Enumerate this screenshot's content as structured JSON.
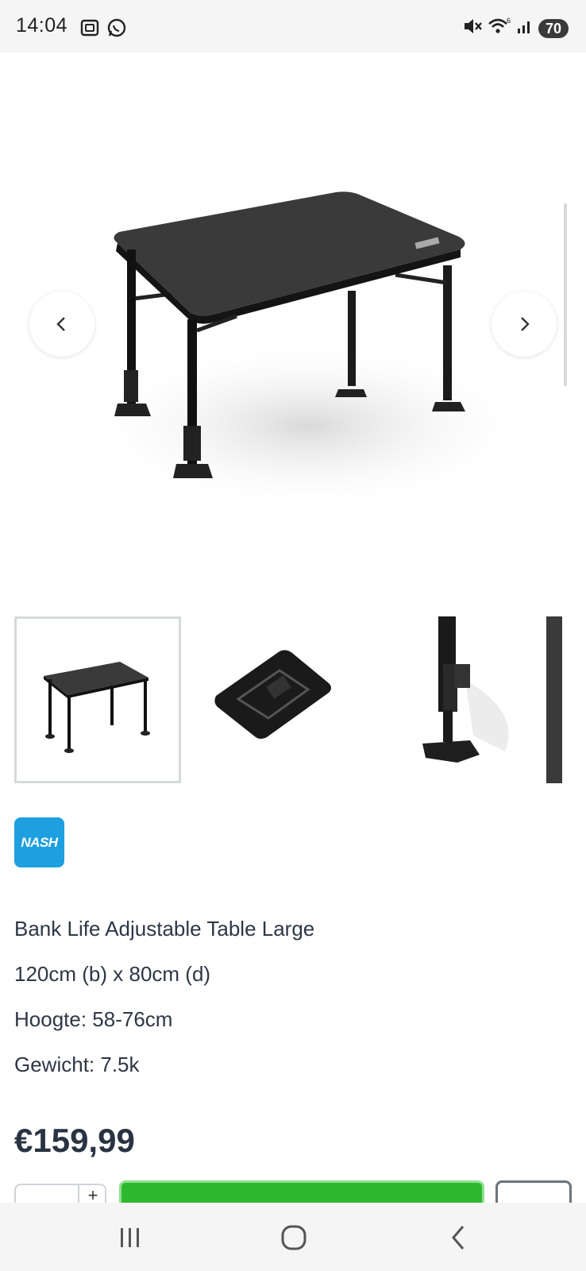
{
  "status_bar": {
    "time": "14:04",
    "battery": "70",
    "left_icons": [
      "screenshot-icon",
      "whatsapp-icon"
    ],
    "right_icons": [
      "mute-icon",
      "wifi-icon",
      "signal-icon",
      "battery-icon"
    ]
  },
  "product": {
    "brand_logo_text": "NASH",
    "title": "Bank Life Adjustable Table Large",
    "dimensions": "120cm (b) x 80cm (d)",
    "height": "Hoogte: 58-76cm",
    "weight": "Gewicht: 7.5k",
    "price": "€159,99",
    "qty_plus_label": "+",
    "thumbnails": [
      "table-front",
      "table-folded",
      "table-leg-foot",
      "table-partial"
    ]
  },
  "colors": {
    "brand_blue": "#1e9fe0",
    "add_to_cart_green": "#2eb82e",
    "text_dark": "#2e3646"
  },
  "nav": {
    "icons": [
      "recent-apps-icon",
      "home-icon",
      "back-icon"
    ]
  }
}
